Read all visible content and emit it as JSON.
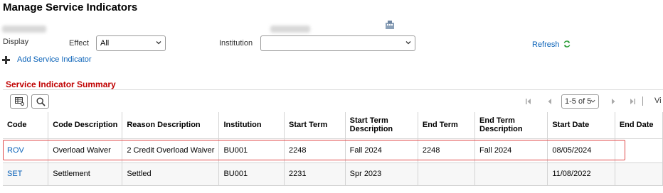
{
  "page": {
    "title": "Manage Service Indicators"
  },
  "filters": {
    "display_label": "Display",
    "effect_label": "Effect",
    "effect_value": "All",
    "institution_label": "Institution",
    "institution_value": "",
    "refresh_label": "Refresh"
  },
  "actions": {
    "add_label": "Add Service Indicator"
  },
  "summary": {
    "title": "Service Indicator Summary",
    "pager_text": "1-5 of 5",
    "view_text": "Vi"
  },
  "table": {
    "columns": [
      "Code",
      "Code Description",
      "Reason Description",
      "Institution",
      "Start Term",
      "Start Term Description",
      "End Term",
      "End Term Description",
      "Start Date",
      "End Date"
    ],
    "rows": [
      [
        "ROV",
        "Overload Waiver",
        "2 Credit Overload Waiver",
        "BU001",
        "2248",
        "Fall 2024",
        "2248",
        "Fall 2024",
        "08/05/2024",
        ""
      ],
      [
        "SET",
        "Settlement",
        "Settled",
        "BU001",
        "2231",
        "Spr 2023",
        "",
        "",
        "11/08/2022",
        ""
      ]
    ]
  },
  "colors": {
    "link": "#0a62b8",
    "section_title": "#c00000",
    "highlight": "#e04a4a"
  }
}
